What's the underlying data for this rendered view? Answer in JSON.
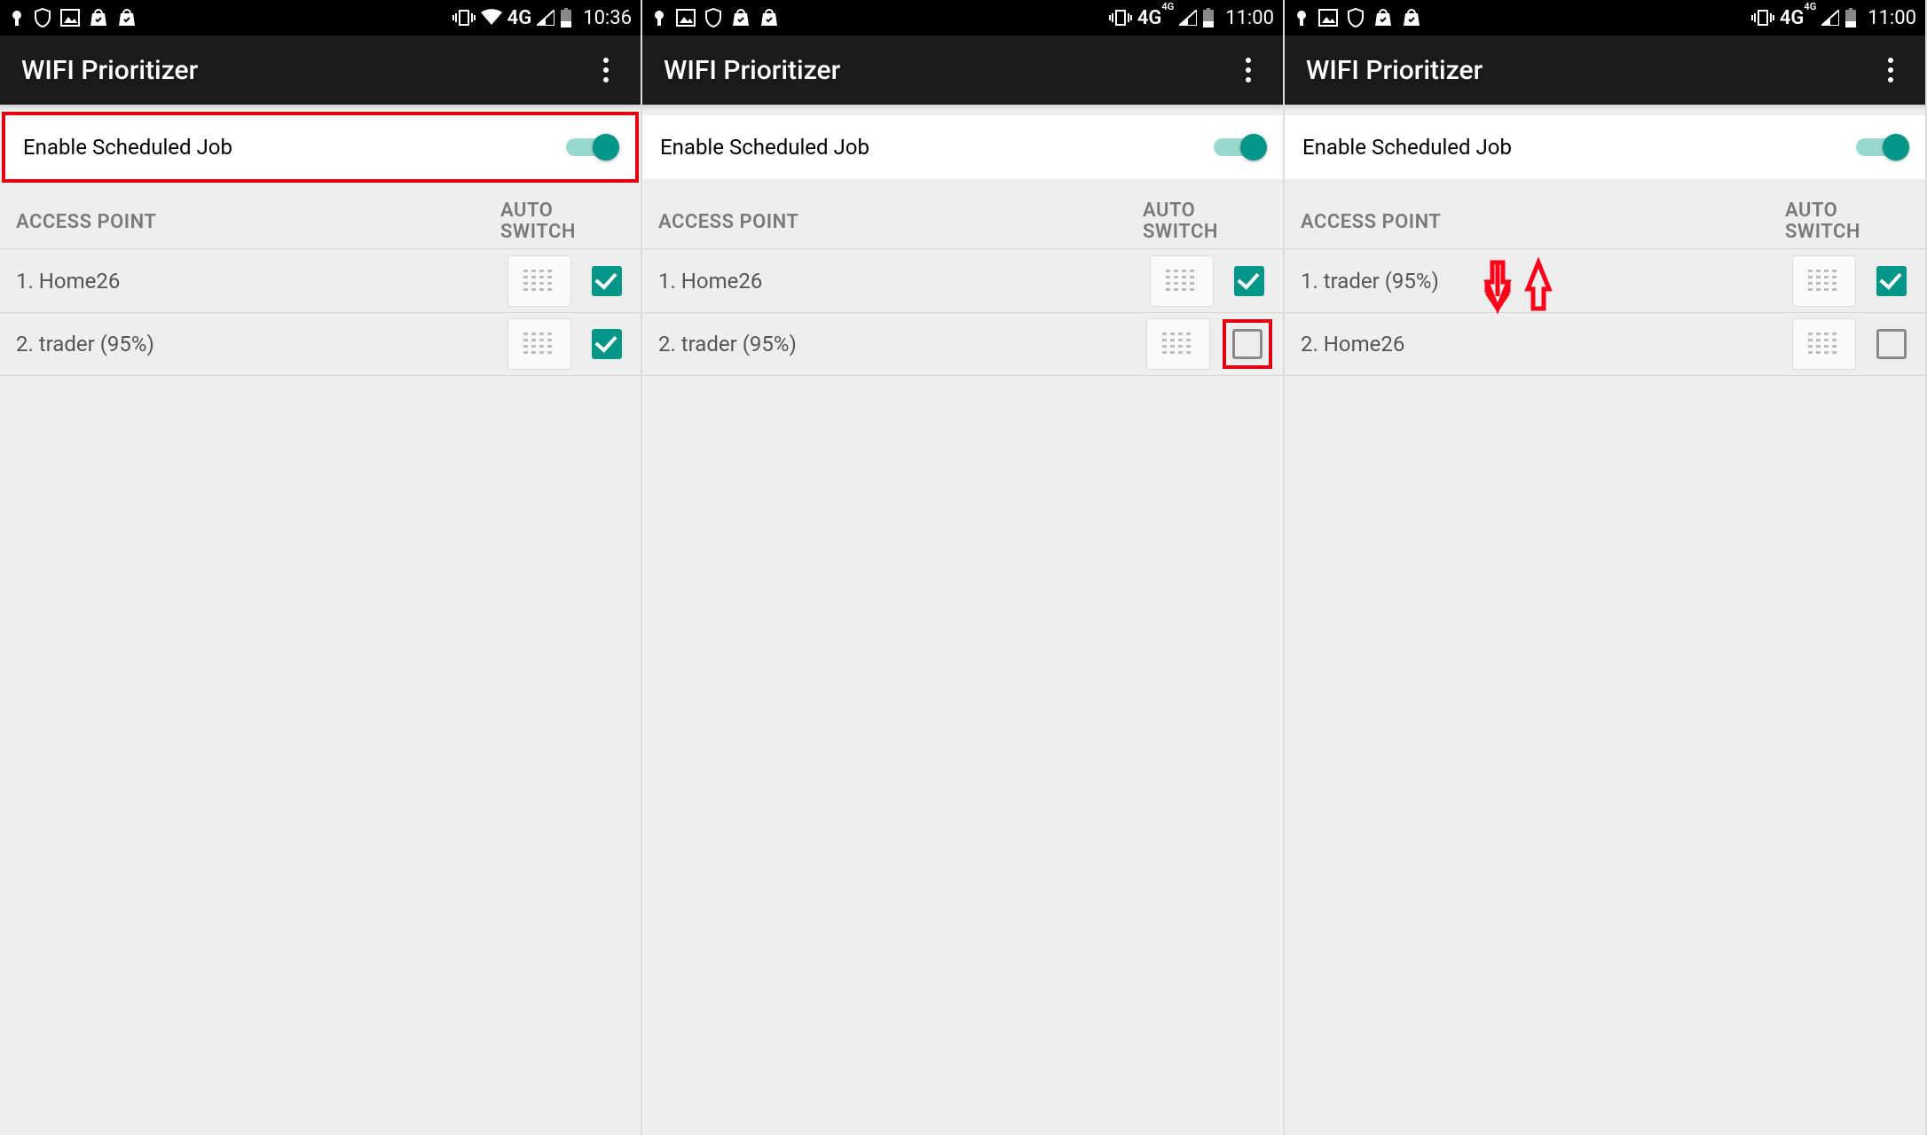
{
  "panels": [
    {
      "statusbar": {
        "time": "10:36",
        "network": "4G",
        "wifi": true,
        "network_sup": ""
      },
      "appbar": {
        "title": "WIFI Prioritizer"
      },
      "enable": {
        "label": "Enable Scheduled Job",
        "on": true,
        "highlight": true
      },
      "headers": {
        "ap": "ACCESS POINT",
        "switch": "AUTO SWITCH"
      },
      "rows": [
        {
          "label": "1. Home26",
          "checked": true
        },
        {
          "label": "2. trader (95%)",
          "checked": true
        }
      ]
    },
    {
      "statusbar": {
        "time": "11:00",
        "network": "4G",
        "wifi": false,
        "network_sup": "4G"
      },
      "appbar": {
        "title": "WIFI Prioritizer"
      },
      "enable": {
        "label": "Enable Scheduled Job",
        "on": true,
        "highlight": false
      },
      "headers": {
        "ap": "ACCESS POINT",
        "switch": "AUTO SWITCH"
      },
      "rows": [
        {
          "label": "1. Home26",
          "checked": true
        },
        {
          "label": "2. trader (95%)",
          "checked": false,
          "highlightCheckbox": true
        }
      ]
    },
    {
      "statusbar": {
        "time": "11:00",
        "network": "4G",
        "wifi": false,
        "network_sup": "4G"
      },
      "appbar": {
        "title": "WIFI Prioritizer"
      },
      "enable": {
        "label": "Enable Scheduled Job",
        "on": true,
        "highlight": false
      },
      "headers": {
        "ap": "ACCESS POINT",
        "switch": "AUTO SWITCH"
      },
      "rows": [
        {
          "label": "1. trader (95%)",
          "checked": true
        },
        {
          "label": "2. Home26",
          "checked": false
        }
      ],
      "swapArrows": true
    }
  ]
}
